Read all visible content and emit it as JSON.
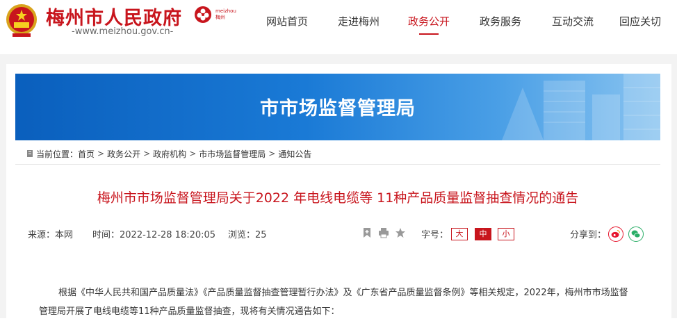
{
  "header": {
    "site_title": "梅州市人民政府",
    "site_url": "-www.meizhou.gov.cn-",
    "brand_text_top": "meizhou",
    "brand_text_bottom": "梅州",
    "nav": [
      {
        "label": "网站首页",
        "active": false
      },
      {
        "label": "走进梅州",
        "active": false
      },
      {
        "label": "政务公开",
        "active": true
      },
      {
        "label": "政务服务",
        "active": false
      },
      {
        "label": "互动交流",
        "active": false
      },
      {
        "label": "回应关切",
        "active": false
      }
    ]
  },
  "banner": {
    "title": "市市场监督管理局"
  },
  "breadcrumb": {
    "prefix": "当前位置：",
    "items": [
      "首页",
      "政务公开",
      "政府机构",
      "市市场监督管理局",
      "通知公告"
    ]
  },
  "article": {
    "title": "梅州市市场监督管理局关于2022 年电线电缆等 11种产品质量监督抽查情况的通告",
    "source": "来源：本网",
    "time": "时间：2022-12-28 18:20:05",
    "views": "浏览：25",
    "font_size_label": "字号：",
    "font_sizes": [
      "大",
      "中",
      "小"
    ],
    "share_label": "分享到：",
    "body": "根据《中华人民共和国产品质量法》《产品质量监督抽查管理暂行办法》及《广东省产品质量监督条例》等相关规定，2022年，梅州市市场监督管理局开展了电线电缆等11种产品质量监督抽查，现将有关情况通告如下："
  },
  "colors": {
    "brand_red": "#c8151d",
    "banner_blue": "#1a7ad6",
    "weibo": "#e6162d",
    "wechat": "#2aae67"
  },
  "icons": [
    "emblem-icon",
    "brand-logo-icon",
    "location-icon",
    "bookmark-icon",
    "print-icon",
    "star-icon",
    "weibo-icon",
    "wechat-icon"
  ]
}
